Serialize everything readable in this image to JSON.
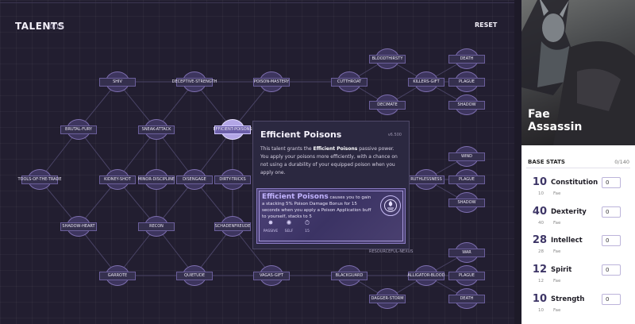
{
  "talents": {
    "title": "TALENTS",
    "count": "0/15",
    "reset_label": "RESET",
    "nodes": [
      {
        "id": "n1",
        "label": "SHIV"
      },
      {
        "id": "n2",
        "label": "DECEPTIVE-STRENGTH"
      },
      {
        "id": "n3",
        "label": "POISON-MASTERY"
      },
      {
        "id": "n4",
        "label": "CUTTHROAT"
      },
      {
        "id": "n5",
        "label": "BLOODTHIRSTY"
      },
      {
        "id": "n6",
        "label": "DECIMATE"
      },
      {
        "id": "n7",
        "label": "KILLERS-GIFT"
      },
      {
        "id": "n8",
        "label": "DEATH"
      },
      {
        "id": "n9",
        "label": "PLAGUE"
      },
      {
        "id": "n10",
        "label": "SHADOW"
      },
      {
        "id": "n11",
        "label": "BRUTAL-FURY"
      },
      {
        "id": "n12",
        "label": "SNEAK-ATTACK"
      },
      {
        "id": "n13",
        "label": "EFFICIENT-POISONS"
      },
      {
        "id": "n14",
        "label": "TOOLS-OF-THE-TRADE"
      },
      {
        "id": "n15",
        "label": "KIDNEY-SHOT"
      },
      {
        "id": "n16",
        "label": "MINOR-DISCIPLINE"
      },
      {
        "id": "n17",
        "label": "DISENGAGE"
      },
      {
        "id": "n18",
        "label": "DIRTY-TRICKS"
      },
      {
        "id": "n19",
        "label": "RUTHLESSNESS"
      },
      {
        "id": "n20",
        "label": "WIND"
      },
      {
        "id": "n21",
        "label": "PLAGUE"
      },
      {
        "id": "n22",
        "label": "SHADOW"
      },
      {
        "id": "n23",
        "label": "SHADOW-HEART"
      },
      {
        "id": "n24",
        "label": "RECON"
      },
      {
        "id": "n25",
        "label": "SCHADENFREUDE"
      },
      {
        "id": "n26",
        "label": "GARROTE"
      },
      {
        "id": "n27",
        "label": "QUIETUDE"
      },
      {
        "id": "n28",
        "label": "VAGAS-GIFT"
      },
      {
        "id": "n29",
        "label": "BLACKGUARD"
      },
      {
        "id": "n30",
        "label": "ALLIGATOR-BLOOD"
      },
      {
        "id": "n31",
        "label": "WAR"
      },
      {
        "id": "n32",
        "label": "PLAGUE"
      },
      {
        "id": "n33",
        "label": "DEATH"
      },
      {
        "id": "n34",
        "label": "DAGGER-STORM"
      }
    ]
  },
  "tooltip": {
    "title": "Efficient Poisons",
    "id_text": "v6.500",
    "desc_pre": "This talent grants the ",
    "desc_bold": "Efficient Poisons",
    "desc_post": " passive power. You apply your poisons more efficiently, with a chance on not using a durability of your equipped poison when you apply one.",
    "card_name": "Efficient Poisons",
    "card_text": " causes you to gain a stacking 5% Poison Damage Bonus for 15 seconds when you apply a Poison Application buff to yourself, stacks to 5",
    "stats": [
      {
        "icon": "passive-icon",
        "glyph": "✸",
        "label": "PASSIVE"
      },
      {
        "icon": "self-icon",
        "glyph": "✺",
        "label": "SELF"
      },
      {
        "icon": "duration-icon",
        "glyph": "⏱",
        "label": "15"
      }
    ],
    "footnote": "RESOURCEFUL-NEXUS"
  },
  "character": {
    "name_line1": "Fae",
    "name_line2": "Assassin"
  },
  "base_stats": {
    "header": "BASE STATS",
    "count": "0/140",
    "stats": [
      {
        "value": "10",
        "name": "Constitution",
        "base": "10",
        "source": "Fae",
        "input": "0"
      },
      {
        "value": "40",
        "name": "Dexterity",
        "base": "40",
        "source": "Fae",
        "input": "0"
      },
      {
        "value": "28",
        "name": "Intellect",
        "base": "28",
        "source": "Fae",
        "input": "0"
      },
      {
        "value": "12",
        "name": "Spirit",
        "base": "12",
        "source": "Fae",
        "input": "0"
      },
      {
        "value": "10",
        "name": "Strength",
        "base": "10",
        "source": "Fae",
        "input": "0"
      }
    ]
  },
  "colors": {
    "tree_bg": "#221e30",
    "node_fill": "#35304e",
    "node_border": "#6a5e9a",
    "active_node": "#b3a6e6",
    "accent": "#3d3566"
  }
}
